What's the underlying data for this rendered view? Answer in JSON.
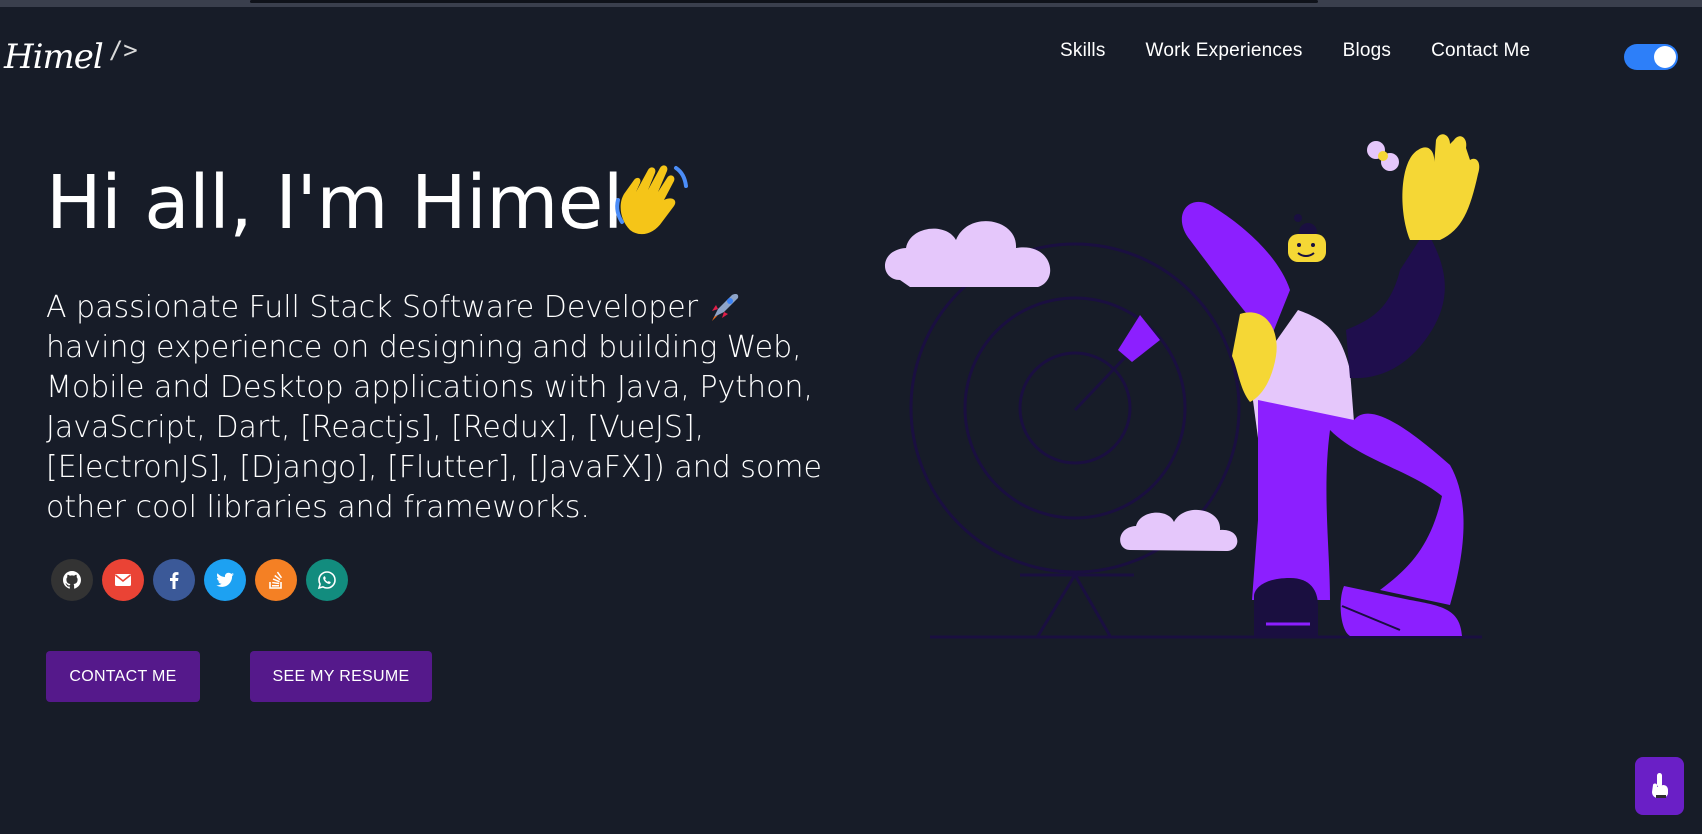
{
  "logo": {
    "signature": "Himel",
    "tag": "/>"
  },
  "nav": {
    "items": [
      "Skills",
      "Work Experiences",
      "Blogs",
      "Contact Me"
    ]
  },
  "theme_toggle": {
    "state": "on",
    "accent": "#2d7ff9"
  },
  "hero": {
    "title": "Hi all, I'm Himel",
    "description": "A passionate Full Stack Software Developer",
    "description_rest": "having experience on designing and building Web, Mobile and Desktop applications with Java, Python, JavaScript, Dart, [Reactjs], [Redux], [VueJS], [ElectronJS], [Django], [Flutter], [JavaFX]) and some other cool libraries and frameworks."
  },
  "socials": [
    {
      "name": "github-icon",
      "color": "#333333"
    },
    {
      "name": "email-icon",
      "color": "#ea4335"
    },
    {
      "name": "facebook-icon",
      "color": "#3b5998"
    },
    {
      "name": "twitter-icon",
      "color": "#1da1f2"
    },
    {
      "name": "stackoverflow-icon",
      "color": "#f48024"
    },
    {
      "name": "whatsapp-icon",
      "color": "#128c7e"
    }
  ],
  "buttons": {
    "contact": "CONTACT ME",
    "resume": "SEE MY RESUME"
  },
  "colors": {
    "background": "#171c28",
    "button": "#55198b",
    "fab": "#6a1fc6"
  }
}
